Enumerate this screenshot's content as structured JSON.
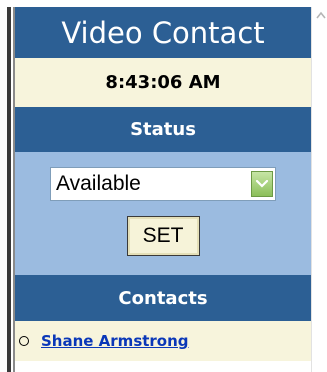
{
  "header": {
    "title": "Video Contact"
  },
  "clock": {
    "time": "8:43:06 AM"
  },
  "status_section": {
    "heading": "Status",
    "selected_status": "Available",
    "set_label": "SET"
  },
  "contacts_section": {
    "heading": "Contacts",
    "items": [
      {
        "name": "Shane Armstrong"
      }
    ]
  },
  "colors": {
    "header_blue": "#2c5f94",
    "panel_light_blue": "#9bbbe0",
    "cream": "#f7f4dc",
    "link_blue": "#0a37b8"
  },
  "icons": {
    "dropdown": "chevron-down-icon",
    "bullet": "circle-bullet-icon",
    "scroll": "scroll-up-arrow-icon"
  }
}
